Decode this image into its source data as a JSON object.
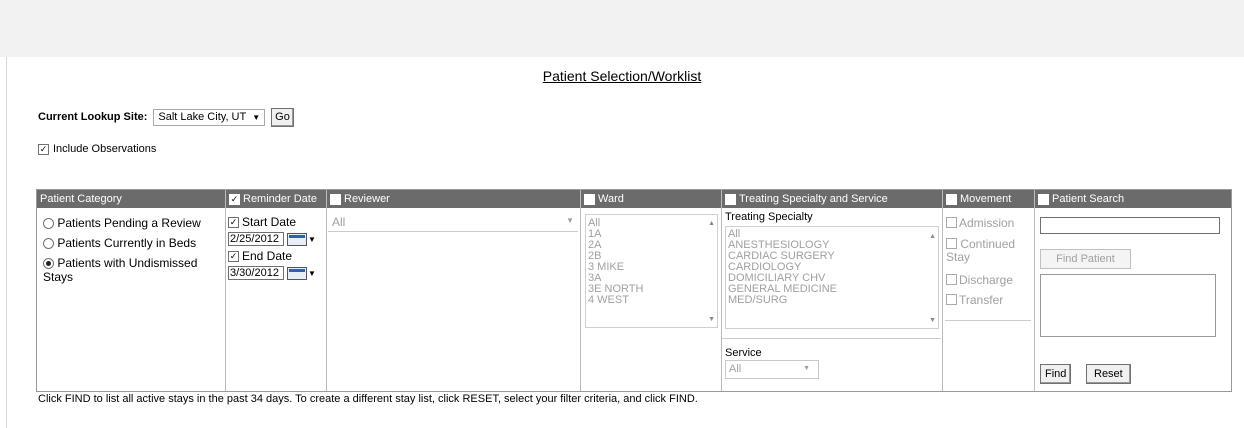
{
  "page": {
    "title": "Patient Selection/Worklist",
    "lookup_label": "Current Lookup Site:",
    "lookup_value": "Salt Lake City, UT",
    "go_label": "Go",
    "include_observations": {
      "label": "Include Observations",
      "checked": true
    }
  },
  "patient_category": {
    "header": "Patient Category",
    "options": [
      {
        "label": "Patients Pending a Review",
        "selected": false
      },
      {
        "label": "Patients Currently in Beds",
        "selected": false
      },
      {
        "label": "Patients with Undismissed Stays",
        "selected": true
      }
    ]
  },
  "reminder_date": {
    "header": "Reminder Date",
    "start_label": "Start Date",
    "start_value": "2/25/2012",
    "end_label": "End Date",
    "end_value": "3/30/2012"
  },
  "reviewer": {
    "header": "Reviewer",
    "value": "All"
  },
  "ward": {
    "header": "Ward",
    "items": [
      "All",
      "1A",
      "2A",
      "2B",
      "3 MIKE",
      "3A",
      "3E NORTH",
      "4 WEST"
    ]
  },
  "treating_specialty": {
    "header": "Treating Specialty and Service",
    "sub_label": "Treating Specialty",
    "items": [
      "All",
      "ANESTHESIOLOGY",
      "CARDIAC SURGERY",
      "CARDIOLOGY",
      "DOMICILIARY CHV",
      "GENERAL MEDICINE",
      "MED/SURG"
    ],
    "service_label": "Service",
    "service_value": "All"
  },
  "movement": {
    "header": "Movement",
    "items": [
      "Admission",
      "Continued Stay",
      "Discharge",
      "Transfer"
    ]
  },
  "patient_search": {
    "header": "Patient Search",
    "find_patient_label": "Find Patient",
    "find_label": "Find",
    "reset_label": "Reset"
  },
  "footer_text": "Click FIND to list all active stays in the past 34 days. To create a different stay list, click RESET, select your filter criteria, and click FIND.",
  "colors": {
    "header_bg": "#6b6b6b",
    "disabled_text": "#a0a0a0"
  }
}
